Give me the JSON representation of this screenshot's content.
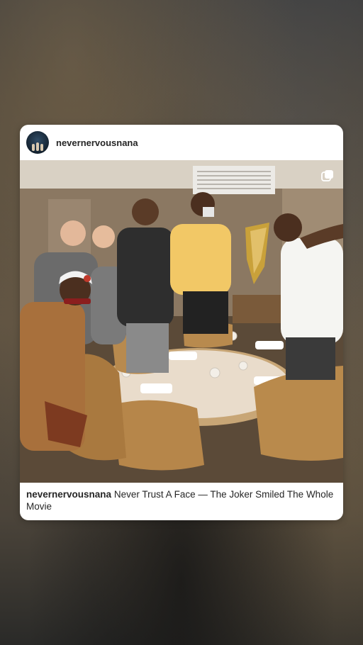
{
  "post": {
    "username": "nevernervousnana",
    "caption_username": "nevernervousnana",
    "caption_text": "Never Trust A Face — The Joker Smiled The Whole Movie"
  },
  "icons": {
    "share": "copy-icon",
    "avatar": "profile-avatar"
  },
  "colors": {
    "card_bg": "#ffffff",
    "text": "#262626"
  }
}
